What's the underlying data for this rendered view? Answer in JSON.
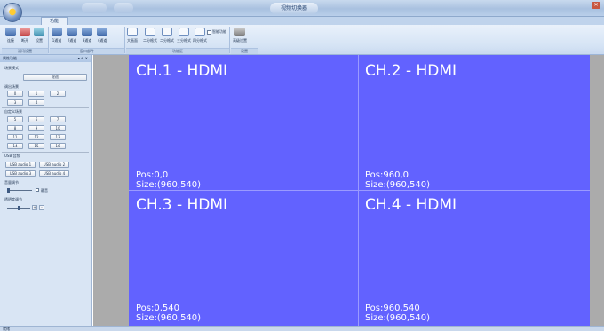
{
  "window": {
    "title": "视频切换器"
  },
  "tabs": [
    {
      "label": "功能"
    }
  ],
  "ribbon": {
    "buttons": [
      {
        "label": "连接",
        "icon": "connect-icon"
      },
      {
        "label": "断开",
        "icon": "disconnect-icon"
      },
      {
        "label": "设置",
        "icon": "settings-icon"
      },
      {
        "label": "1通道",
        "icon": "channel-icon"
      },
      {
        "label": "2通道",
        "icon": "channel-icon"
      },
      {
        "label": "3通道",
        "icon": "channel-icon"
      },
      {
        "label": "4通道",
        "icon": "channel-icon"
      },
      {
        "label": "大画面",
        "icon": "layout-icon"
      },
      {
        "label": "二分格式",
        "icon": "layout-icon"
      },
      {
        "label": "二分格式",
        "icon": "layout-icon"
      },
      {
        "label": "三分格式",
        "icon": "layout-icon"
      },
      {
        "label": "四分格式",
        "icon": "layout-icon"
      },
      {
        "label": "高级设置",
        "icon": "advanced-settings-icon"
      }
    ],
    "smart_checkbox_label": "智能功能",
    "groups": [
      {
        "label": "通讯设置"
      },
      {
        "label": "窗口部件"
      },
      {
        "label": "功能区"
      },
      {
        "label": "设置"
      }
    ]
  },
  "panel": {
    "title": "属性功能",
    "pin_controls": "▾ ⊕ ✕",
    "mode_label": "场景模式",
    "mode_button": "轮巡",
    "call_scene_label": "调出场景",
    "call_scene_buttons": [
      "0",
      "1",
      "2",
      "3",
      "4"
    ],
    "custom_scene_label": "自定义场景",
    "custom_scene_buttons": [
      "5",
      "6",
      "7",
      "8",
      "9",
      "10",
      "11",
      "12",
      "13",
      "14",
      "15",
      "16"
    ],
    "usb_label": "USB 音频",
    "usb_buttons": [
      "USB audio 1",
      "USB audio 2",
      "USB audio 3",
      "USB audio 4"
    ],
    "volume_label": "音量调节",
    "mute_label": "静音",
    "transparency_label": "透明度调节",
    "spin_plus": "+",
    "spin_minus": "-"
  },
  "channels": [
    {
      "title": "CH.1 - HDMI",
      "pos": "Pos:0,0",
      "size": "Size:(960,540)"
    },
    {
      "title": "CH.2 - HDMI",
      "pos": "Pos:960,0",
      "size": "Size:(960,540)"
    },
    {
      "title": "CH.3 - HDMI",
      "pos": "Pos:0,540",
      "size": "Size:(960,540)"
    },
    {
      "title": "CH.4 - HDMI",
      "pos": "Pos:960,540",
      "size": "Size:(960,540)"
    }
  ],
  "status": {
    "text": "就绪"
  },
  "colors": {
    "canvas": "#6262ff",
    "workspace": "#ababab",
    "ribbon": "#d6e4f5"
  }
}
